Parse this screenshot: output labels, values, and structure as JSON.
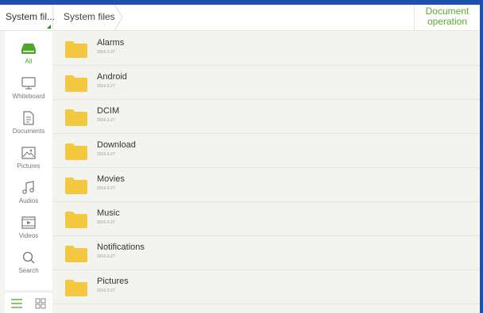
{
  "topbar": {
    "dropdown_label": "System fil...",
    "breadcrumb": "System files",
    "document_operation": "Document operation"
  },
  "sidebar": {
    "items": [
      {
        "label": "All",
        "icon": "drive-icon",
        "active": true
      },
      {
        "label": "Whiteboard",
        "icon": "monitor-icon",
        "active": false
      },
      {
        "label": "Documents",
        "icon": "document-icon",
        "active": false
      },
      {
        "label": "Pictures",
        "icon": "picture-icon",
        "active": false
      },
      {
        "label": "Audios",
        "icon": "music-note-icon",
        "active": false
      },
      {
        "label": "Videos",
        "icon": "video-icon",
        "active": false
      },
      {
        "label": "Search",
        "icon": "search-icon",
        "active": false
      }
    ],
    "view_modes": [
      "list-view-icon",
      "grid-view-icon"
    ]
  },
  "files": [
    {
      "name": "Alarms",
      "date": "2016-3-27"
    },
    {
      "name": "Android",
      "date": "2016-3-27"
    },
    {
      "name": "DCIM",
      "date": "2016-3-27"
    },
    {
      "name": "Download",
      "date": "2016-3-27"
    },
    {
      "name": "Movies",
      "date": "2016-3-27"
    },
    {
      "name": "Music",
      "date": "2016-3-27"
    },
    {
      "name": "Notifications",
      "date": "2016-3-27"
    },
    {
      "name": "Pictures",
      "date": "2016-3-27"
    }
  ],
  "colors": {
    "accent": "#4ea82a",
    "folder": "#f5c842",
    "background": "#f3f3ef"
  }
}
